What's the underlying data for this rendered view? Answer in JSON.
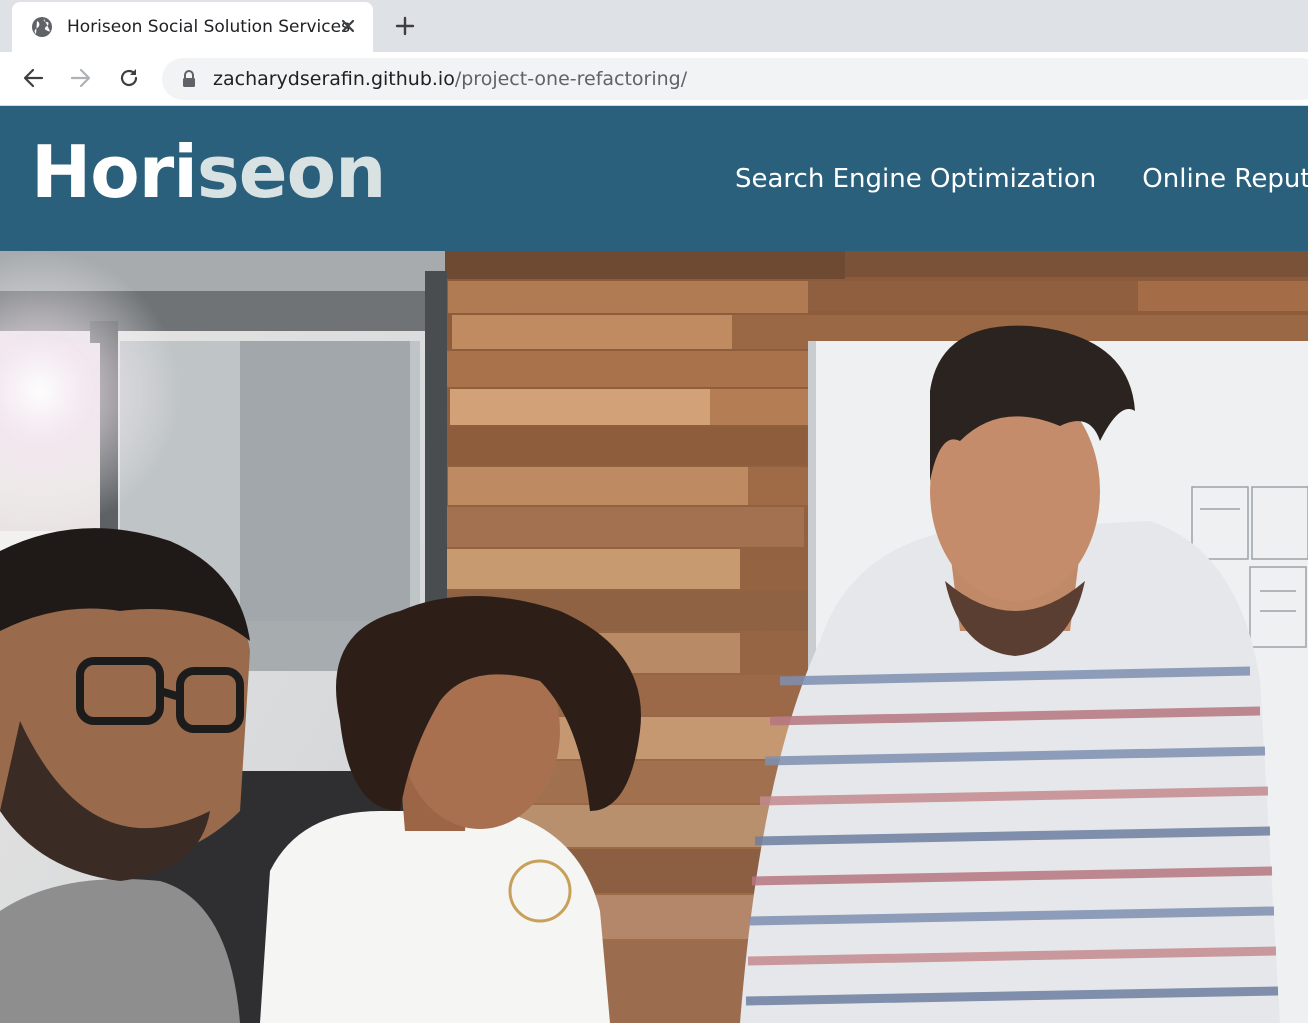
{
  "browser": {
    "tab": {
      "title": "Horiseon Social Solution Services",
      "favicon": "globe-icon",
      "close_icon": "close-icon"
    },
    "new_tab_icon": "plus-icon",
    "nav_icons": [
      "back-arrow-icon",
      "forward-arrow-icon",
      "reload-icon"
    ],
    "address_bar": {
      "lock_icon": "lock-icon",
      "url_host": "zacharydserafin.github.io",
      "url_path": "/project-one-refactoring/"
    }
  },
  "site": {
    "header_color": "#2a607c",
    "logo": {
      "main": "Hori",
      "accent": "seon"
    },
    "nav": [
      {
        "label": "Search Engine Optimization"
      },
      {
        "label": "Online Reputation Management"
      }
    ]
  },
  "hero": {
    "image": "team-collaboration-photo"
  }
}
